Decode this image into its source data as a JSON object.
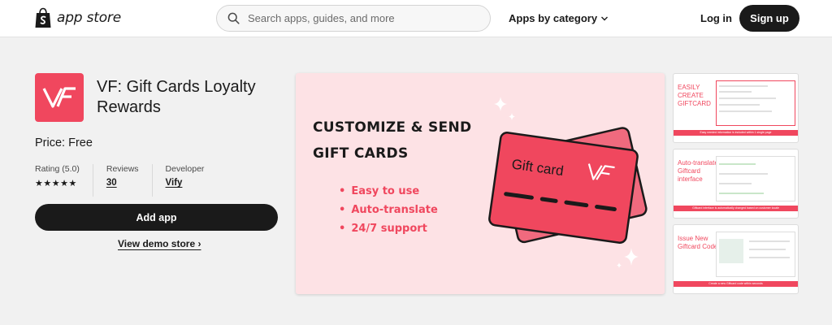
{
  "header": {
    "logo_text": "app store",
    "search_placeholder": "Search apps, guides, and more",
    "category_label": "Apps by category",
    "login_label": "Log in",
    "signup_label": "Sign up"
  },
  "app": {
    "title": "VF: Gift Cards Loyalty Rewards",
    "price": "Price: Free",
    "rating_label": "Rating (5.0)",
    "stars": "★★★★★",
    "reviews_label": "Reviews",
    "reviews_count": "30",
    "developer_label": "Developer",
    "developer_name": "Vify",
    "add_button": "Add app",
    "demo_link": "View demo store ›",
    "brand_color": "#f0475e"
  },
  "hero": {
    "headline_1": "CUSTOMIZE & SEND",
    "headline_2": "GIFT CARDS",
    "bullets": [
      "Easy to use",
      "Auto-translate",
      "24/7 support"
    ],
    "card_label": "Gift card"
  },
  "thumbnails": [
    {
      "text": "EASILY CREATE GIFTCARD",
      "caption": "Easy needed information is included within 1 single page"
    },
    {
      "text": "Auto-translate Giftcard interface",
      "caption": "Giftcard interface is automatically changed based on customer locale"
    },
    {
      "text": "Issue New Giftcard Code",
      "caption": "Create a new Giftcard code within seconds"
    }
  ]
}
